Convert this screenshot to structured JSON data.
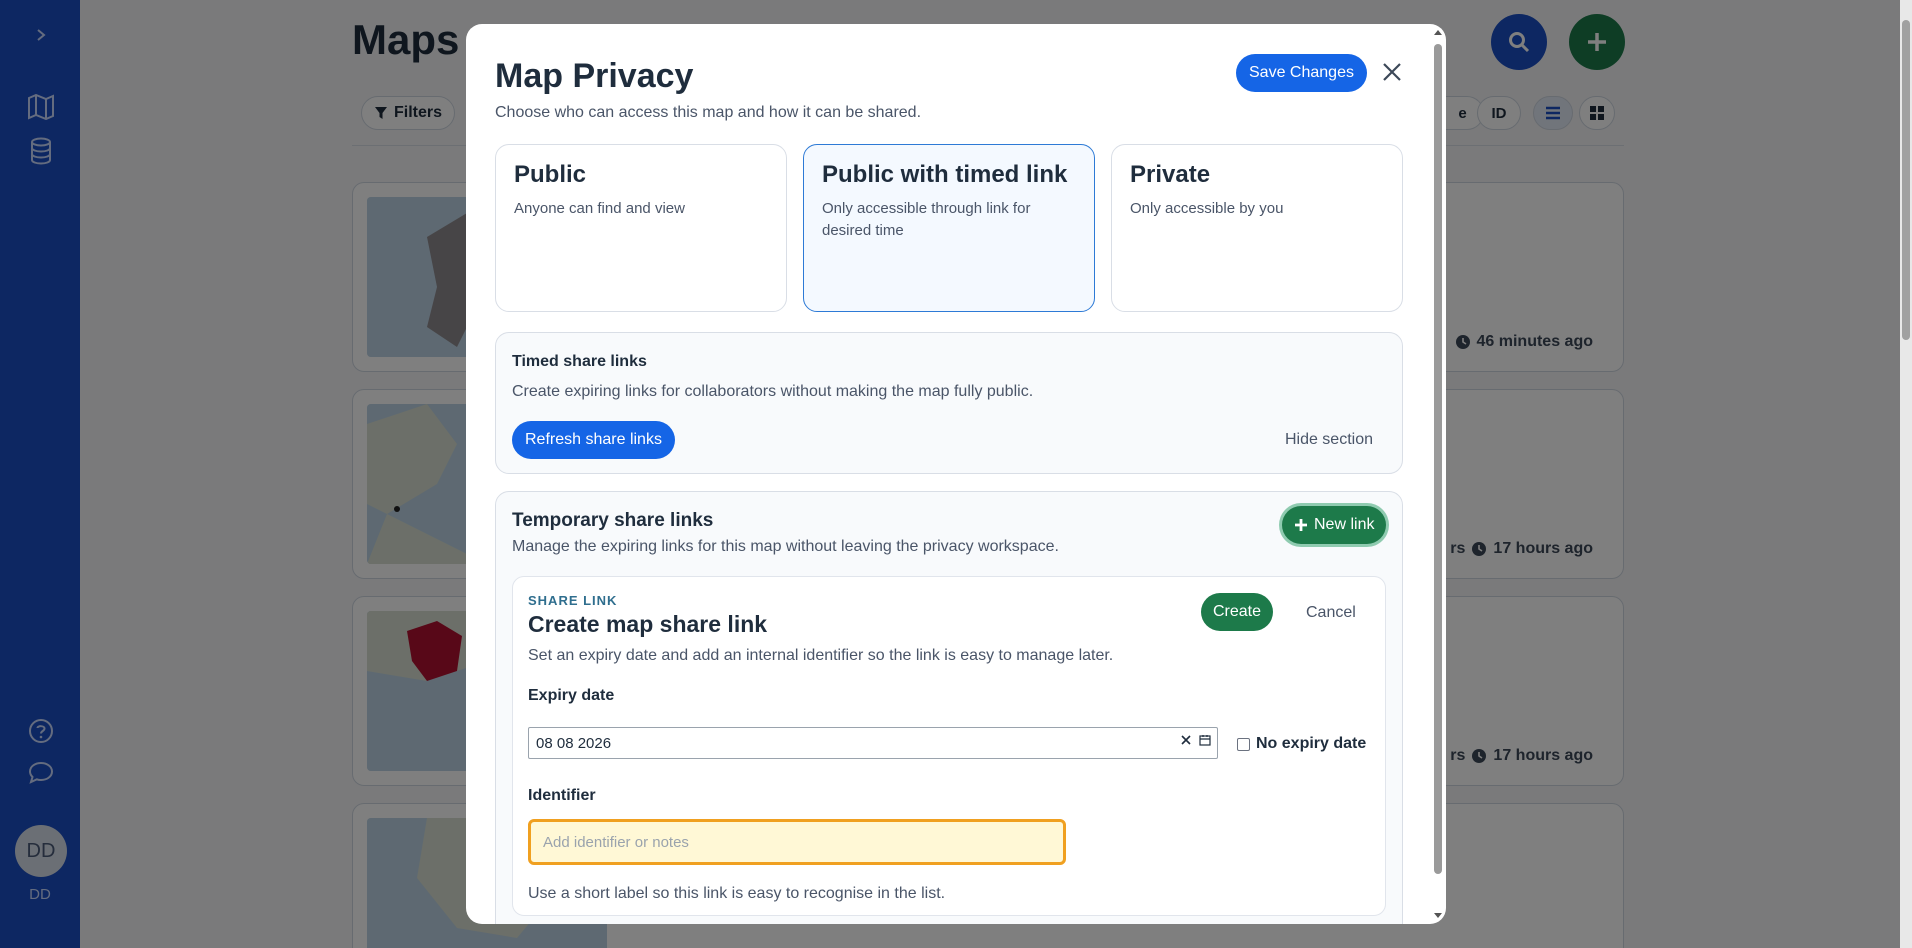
{
  "background": {
    "page_title": "Maps",
    "filters_label": "Filters",
    "view_pill_partial": "e",
    "id_pill": "ID",
    "cards": [
      {
        "time_prefix": "",
        "time": "46 minutes ago"
      },
      {
        "time_prefix": "rs",
        "time": "17 hours ago"
      },
      {
        "time_prefix": "rs",
        "time": "17 hours ago"
      }
    ]
  },
  "sidebar": {
    "avatar_initials": "DD",
    "avatar_label": "DD"
  },
  "modal": {
    "title": "Map Privacy",
    "subtitle": "Choose who can access this map and how it can be shared.",
    "save_label": "Save Changes",
    "options": [
      {
        "title": "Public",
        "desc": "Anyone can find and view",
        "selected": false
      },
      {
        "title": "Public with timed link",
        "desc": "Only accessible through link for desired time",
        "selected": true
      },
      {
        "title": "Private",
        "desc": "Only accessible by you",
        "selected": false
      }
    ],
    "timed_section": {
      "title": "Timed share links",
      "text": "Create expiring links for collaborators without making the map fully public.",
      "refresh_label": "Refresh share links",
      "hide_label": "Hide section"
    },
    "temp_section": {
      "title": "Temporary share links",
      "text": "Manage the expiring links for this map without leaving the privacy workspace.",
      "new_link_label": "New link"
    },
    "create_form": {
      "kicker": "SHARE LINK",
      "title": "Create map share link",
      "desc": "Set an expiry date and add an internal identifier so the link is easy to manage later.",
      "create_label": "Create",
      "cancel_label": "Cancel",
      "expiry_label": "Expiry date",
      "expiry_value": "08 08 2026",
      "no_expiry_label": "No expiry date",
      "identifier_label": "Identifier",
      "identifier_placeholder": "Add identifier or notes",
      "helper": "Use a short label so this link is easy to recognise in the list."
    }
  },
  "colors": {
    "sidebar": "#1a4fc4",
    "primary": "#1565e6",
    "success": "#1d7a4a",
    "focus": "#f0a020"
  }
}
